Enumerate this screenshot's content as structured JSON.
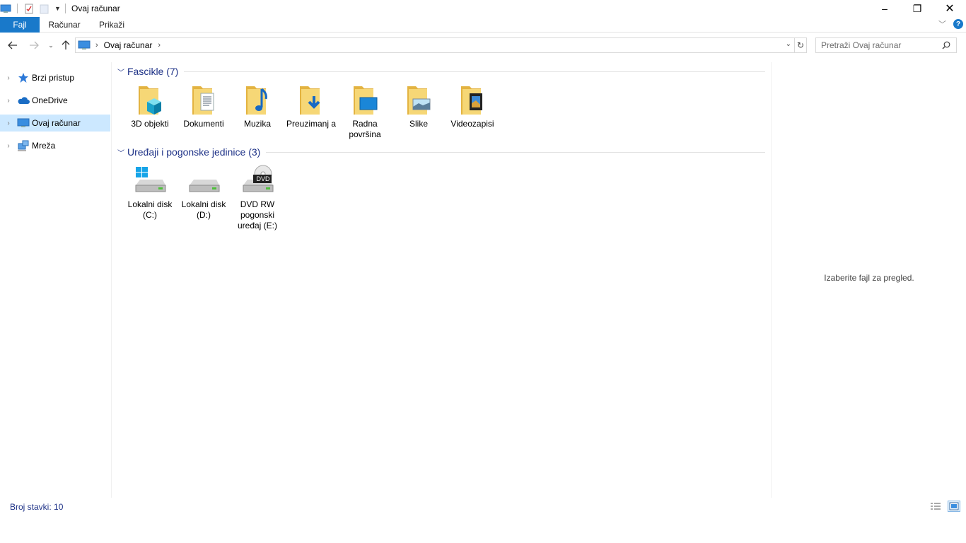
{
  "window": {
    "title": "Ovaj računar",
    "controls": {
      "minimize": "–",
      "maximize": "❐",
      "close": "✕"
    }
  },
  "ribbon": {
    "tabs": [
      {
        "label": "Fajl"
      },
      {
        "label": "Računar"
      },
      {
        "label": "Prikaži"
      }
    ],
    "help": "?"
  },
  "address": {
    "crumbs": [
      "Ovaj računar"
    ],
    "search_placeholder": "Pretraži Ovaj računar"
  },
  "navigation": {
    "items": [
      {
        "label": "Brzi pristup",
        "icon": "star-icon",
        "selected": false
      },
      {
        "label": "OneDrive",
        "icon": "cloud-icon",
        "selected": false
      },
      {
        "label": "Ovaj računar",
        "icon": "computer-icon",
        "selected": true
      },
      {
        "label": "Mreža",
        "icon": "network-icon",
        "selected": false
      }
    ]
  },
  "groups": [
    {
      "title": "Fascikle (7)",
      "items": [
        {
          "label": "3D objekti",
          "icon": "folder-3d-icon"
        },
        {
          "label": "Dokumenti",
          "icon": "folder-documents-icon"
        },
        {
          "label": "Muzika",
          "icon": "folder-music-icon"
        },
        {
          "label": "Preuzimanj a",
          "icon": "folder-downloads-icon"
        },
        {
          "label": "Radna površina",
          "icon": "folder-desktop-icon"
        },
        {
          "label": "Slike",
          "icon": "folder-pictures-icon"
        },
        {
          "label": "Videozapisi",
          "icon": "folder-videos-icon"
        }
      ]
    },
    {
      "title": "Uređaji i pogonske jedinice (3)",
      "items": [
        {
          "label": "Lokalni disk (C:)",
          "icon": "windows-drive-icon"
        },
        {
          "label": "Lokalni disk (D:)",
          "icon": "drive-icon"
        },
        {
          "label": "DVD RW pogonski uređaj (E:)",
          "icon": "dvd-drive-icon",
          "badge": "DVD"
        }
      ]
    }
  ],
  "preview": {
    "message": "Izaberite fajl za pregled."
  },
  "status": {
    "text": "Broj stavki: 10"
  },
  "colors": {
    "accent": "#1979ca",
    "selection": "#cce8ff",
    "group_text": "#1e3287",
    "folder": "#f4d06f"
  }
}
